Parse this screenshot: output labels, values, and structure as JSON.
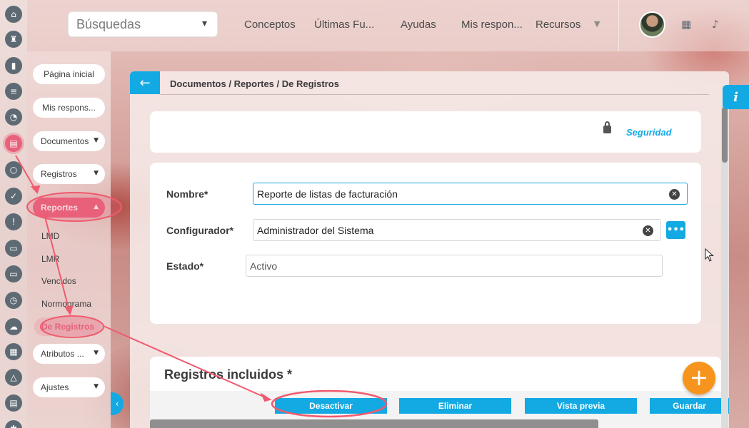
{
  "header": {
    "search_placeholder": "Búsquedas",
    "nav": [
      "Conceptos",
      "Últimas Fu...",
      "Ayudas",
      "Mis respon...",
      "Recursos"
    ]
  },
  "sidebar": {
    "items": {
      "inicio": "Página inicial",
      "mis": "Mis respons...",
      "documentos": "Documentos",
      "registros": "Registros",
      "reportes": "Reportes",
      "atributos": "Atributos ...",
      "ajustes": "Ajustes"
    },
    "subitems": [
      "LMD",
      "LMR",
      "Vencidos",
      "Normograma",
      "De Registros"
    ]
  },
  "breadcrumb": "Documentos / Reportes / De Registros",
  "security_label": "Seguridad",
  "form": {
    "nombre_label": "Nombre*",
    "nombre_value": "Reporte de listas de facturación",
    "configurador_label": "Configurador*",
    "configurador_value": "Administrador del Sistema",
    "estado_label": "Estado*",
    "estado_value": "Activo"
  },
  "section_title": "Registros incluidos *",
  "actions": {
    "desactivar": "Desactivar",
    "eliminar": "Eliminar",
    "vista_previa": "Vista previa",
    "guardar": "Guardar"
  },
  "colors": {
    "accent": "#13a9e3",
    "highlight": "#e8617a",
    "fab": "#f7941d"
  }
}
